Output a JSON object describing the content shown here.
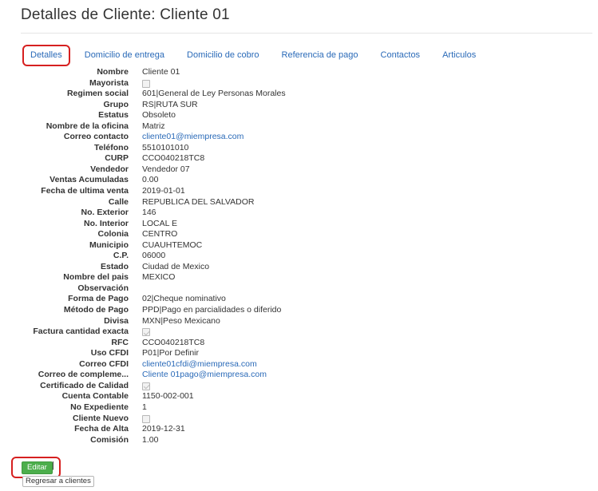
{
  "page": {
    "title": "Detalles de Cliente: Cliente 01"
  },
  "tabs": [
    {
      "label": "Detalles",
      "active": true
    },
    {
      "label": "Domicilio de entrega"
    },
    {
      "label": "Domicilio de cobro"
    },
    {
      "label": "Referencia de pago"
    },
    {
      "label": "Contactos"
    },
    {
      "label": "Articulos"
    }
  ],
  "fields": {
    "nombre": {
      "label": "Nombre",
      "value": "Cliente 01"
    },
    "mayorista": {
      "label": "Mayorista",
      "checked": false
    },
    "regimen_social": {
      "label": "Regimen social",
      "value": "601|General de Ley Personas Morales"
    },
    "grupo": {
      "label": "Grupo",
      "value": "RS|RUTA SUR"
    },
    "estatus": {
      "label": "Estatus",
      "value": "Obsoleto"
    },
    "nombre_oficina": {
      "label": "Nombre de la oficina",
      "value": "Matriz"
    },
    "correo_contacto": {
      "label": "Correo contacto",
      "value": "cliente01@miempresa.com"
    },
    "telefono": {
      "label": "Teléfono",
      "value": "5510101010"
    },
    "curp": {
      "label": "CURP",
      "value": "CCO040218TC8"
    },
    "vendedor": {
      "label": "Vendedor",
      "value": "Vendedor 07"
    },
    "ventas_acumuladas": {
      "label": "Ventas Acumuladas",
      "value": "0.00"
    },
    "fecha_ultima_venta": {
      "label": "Fecha de ultima venta",
      "value": "2019-01-01"
    },
    "calle": {
      "label": "Calle",
      "value": "REPUBLICA DEL SALVADOR"
    },
    "no_exterior": {
      "label": "No. Exterior",
      "value": "146"
    },
    "no_interior": {
      "label": "No. Interior",
      "value": "LOCAL E"
    },
    "colonia": {
      "label": "Colonia",
      "value": "CENTRO"
    },
    "municipio": {
      "label": "Municipio",
      "value": "CUAUHTEMOC"
    },
    "cp": {
      "label": "C.P.",
      "value": "06000"
    },
    "estado": {
      "label": "Estado",
      "value": "Ciudad de Mexico"
    },
    "nombre_pais": {
      "label": "Nombre del pais",
      "value": "MEXICO"
    },
    "observacion": {
      "label": "Observación",
      "value": ""
    },
    "forma_pago": {
      "label": "Forma de Pago",
      "value": "02|Cheque nominativo"
    },
    "metodo_pago": {
      "label": "Método de Pago",
      "value": "PPD|Pago en parcialidades o diferido"
    },
    "divisa": {
      "label": "Divisa",
      "value": "MXN|Peso Mexicano"
    },
    "factura_cantidad_exacta": {
      "label": "Factura cantidad exacta",
      "checked": true
    },
    "rfc": {
      "label": "RFC",
      "value": "CCO040218TC8"
    },
    "uso_cfdi": {
      "label": "Uso CFDI",
      "value": "P01|Por Definir"
    },
    "correo_cfdi": {
      "label": "Correo CFDI",
      "value": "cliente01cfdi@miempresa.com"
    },
    "correo_complemento": {
      "label": "Correo de compleme...",
      "value": "Cliente 01pago@miempresa.com"
    },
    "certificado_calidad": {
      "label": "Certificado de Calidad",
      "checked": true
    },
    "cuenta_contable": {
      "label": "Cuenta Contable",
      "value": "1150-002-001"
    },
    "no_expediente": {
      "label": "No Expediente",
      "value": "1"
    },
    "cliente_nuevo": {
      "label": "Cliente Nuevo",
      "checked": false
    },
    "fecha_alta": {
      "label": "Fecha de Alta",
      "value": "2019-12-31"
    },
    "comision": {
      "label": "Comisión",
      "value": "1.00"
    }
  },
  "actions": {
    "edit_label": "Editar",
    "separator": "|",
    "back_label": "Regresar a clientes"
  },
  "colors": {
    "link": "#2a6ab8",
    "highlight": "#d62020",
    "edit_button": "#4cae4c"
  }
}
